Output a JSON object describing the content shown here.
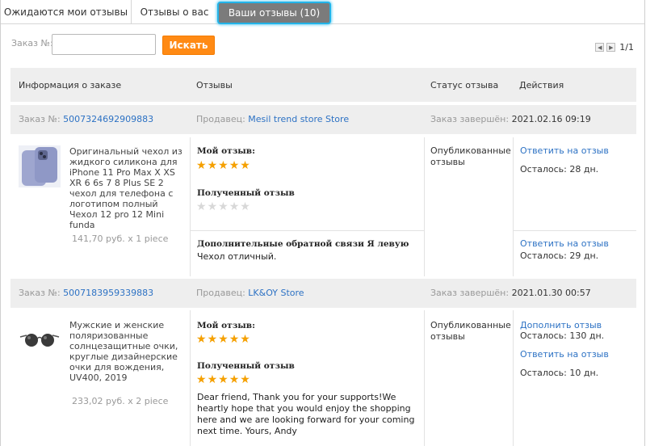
{
  "tabs": [
    {
      "label": "Ожидаются мои отзывы"
    },
    {
      "label": "Отзывы о вас"
    },
    {
      "label": "Ваши отзывы (10)"
    }
  ],
  "search": {
    "label": "Заказ №:",
    "value": "",
    "button": "Искать"
  },
  "pager": {
    "text": "1/1"
  },
  "table": {
    "headers": [
      "Информация о заказе",
      "Отзывы",
      "Статус отзыва",
      "Действия"
    ]
  },
  "labels": {
    "order": "Заказ №:",
    "seller": "Продавец:",
    "completed": "Заказ завершён:",
    "my_review": "Мой отзыв:",
    "received_review": "Полученный отзыв",
    "extra_feedback": "Дополнительные обратной связи Я левую"
  },
  "orders": [
    {
      "order_no": "5007324692909883",
      "seller": "Mesil trend store Store",
      "completed_at": "2021.02.16 09:19",
      "product": "Оригинальный чехол из жидкого силикона для iPhone 11 Pro Max X XS XR 6 6s 7 8 Plus SE 2 чехол для телефона с логотипом полный Чехол 12 pro 12 Mini funda",
      "price": "141,70 руб. x 1 piece",
      "my_rating": 5,
      "received_rating": 0,
      "status": "Опубликованные отзывы",
      "action1_link": "Ответить на отзыв",
      "action1_remaining": "Осталось: 28 дн.",
      "extra_text": "Чехол отличный.",
      "action2_link": "Ответить на отзыв",
      "action2_remaining": "Осталось: 29 дн."
    },
    {
      "order_no": "5007183959339883",
      "seller": "LK&OY Store",
      "completed_at": "2021.01.30 00:57",
      "product": "Мужские и женские поляризованные солнцезащитные очки, круглые дизайнерские очки для вождения, UV400, 2019",
      "price": "233,02 руб. x 2 piece",
      "my_rating": 5,
      "received_rating": 5,
      "received_text": "Dear friend, Thank you for your supports!We heartly hope that you would enjoy the shopping here and we are looking forward for your coming next time. Yours, Andy",
      "status": "Опубликованные отзывы",
      "action1_link": "Дополнить отзыв",
      "action1_remaining": "Осталось: 130 дн.",
      "action2_link": "Ответить на отзыв",
      "action2_remaining": "Осталось: 10 дн."
    }
  ],
  "colors": {
    "accent_tab": "#7b7b7b",
    "tab_highlight": "#22b3e8",
    "search_button": "#ff8a14",
    "link": "#2d72c4",
    "star": "#f5a000"
  }
}
